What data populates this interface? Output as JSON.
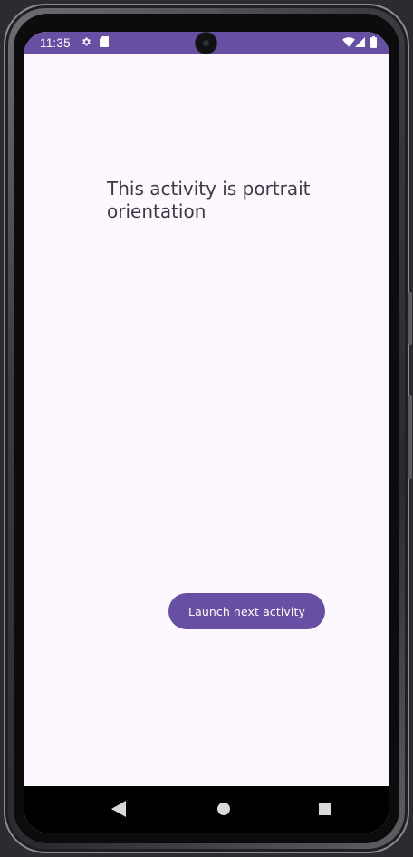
{
  "status_bar": {
    "time": "11:35",
    "icons": [
      "gear-icon",
      "sdcard-icon",
      "wifi-icon",
      "cell-signal-icon",
      "battery-icon"
    ],
    "color": "#6750a4"
  },
  "main": {
    "message": "This activity is portrait orientation",
    "launch_button_label": "Launch next activity"
  },
  "nav_bar": {
    "icons": [
      "back-icon",
      "home-icon",
      "recents-icon"
    ]
  },
  "colors": {
    "primary": "#6750a4",
    "background": "#fdf7ff",
    "text": "#3d3a45"
  }
}
